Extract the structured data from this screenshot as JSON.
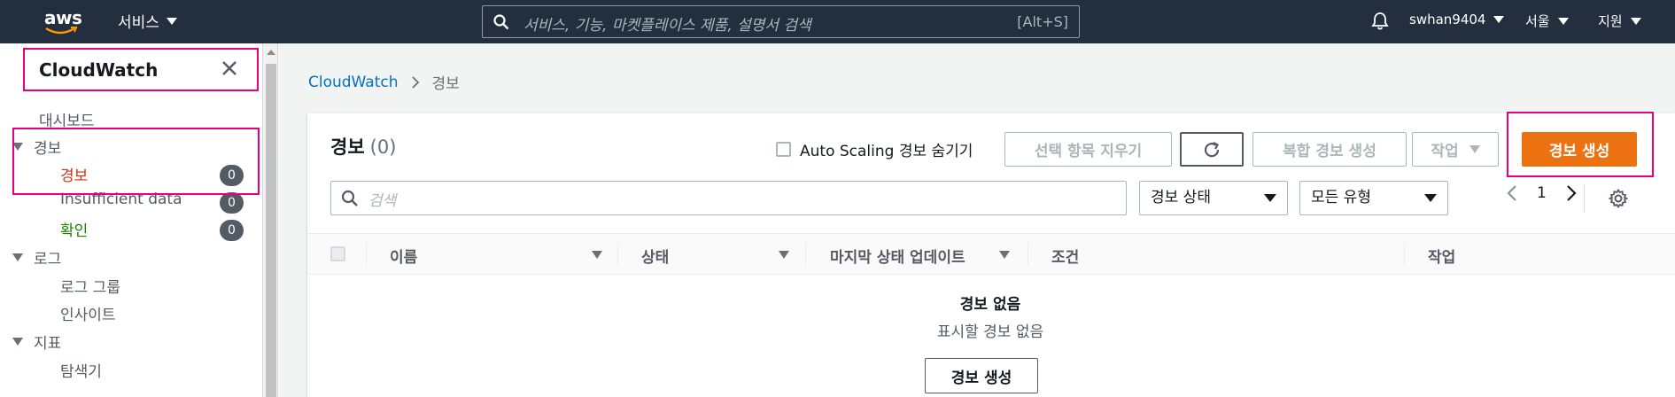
{
  "topnav": {
    "logo_text": "aws",
    "services_label": "서비스",
    "search_placeholder": "서비스, 기능, 마켓플레이스 제품, 설명서 검색",
    "search_shortcut": "[Alt+S]",
    "user": "swhan9404",
    "region": "서울",
    "support": "지원"
  },
  "sidebar": {
    "title": "CloudWatch",
    "dashboard": "대시보드",
    "alarms": {
      "label": "경보",
      "items": [
        {
          "label": "경보",
          "count": "0",
          "color": "#d13212"
        },
        {
          "label": "Insufficient data",
          "count": "0",
          "color": "#545b64"
        },
        {
          "label": "확인",
          "count": "0",
          "color": "#1d8102"
        }
      ]
    },
    "logs": {
      "label": "로그",
      "items": [
        "로그 그룹",
        "인사이트"
      ]
    },
    "metrics": {
      "label": "지표",
      "items": [
        "탐색기"
      ]
    }
  },
  "breadcrumb": {
    "root": "CloudWatch",
    "current": "경보"
  },
  "panel": {
    "title": "경보",
    "count": "(0)",
    "autoscaling_label": "Auto Scaling 경보 숨기기",
    "clear_selection": "선택 항목 지우기",
    "composite_alarm": "복합 경보 생성",
    "actions": "작업",
    "create_alarm": "경보 생성",
    "search_placeholder": "검색",
    "state_filter": "경보 상태",
    "type_filter": "모든 유형",
    "page": "1",
    "columns": [
      "이름",
      "상태",
      "마지막 상태 업데이트",
      "조건",
      "작업"
    ],
    "empty_title": "경보 없음",
    "empty_desc": "표시할 경보 없음",
    "empty_button": "경보 생성"
  },
  "colors": {
    "nav_bg": "#232f3e",
    "primary": "#ec7211",
    "link": "#0073bb",
    "highlight": "#e6007e"
  }
}
